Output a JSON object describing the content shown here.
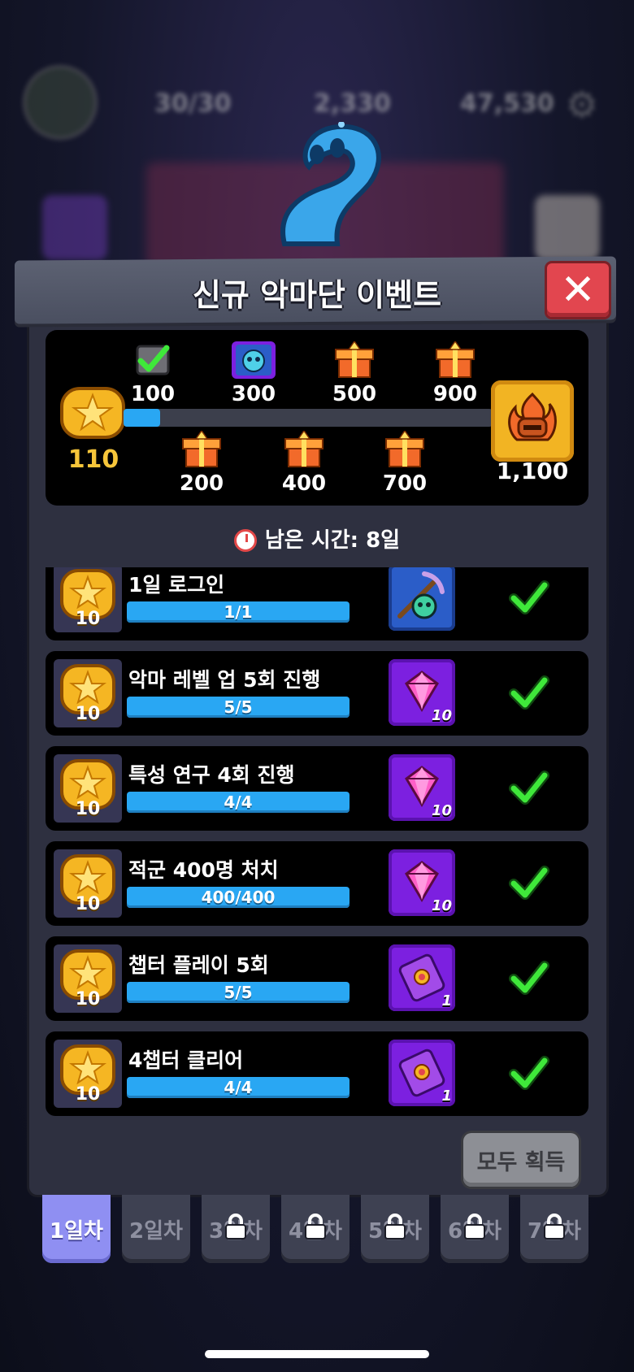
{
  "hud": {
    "energy": "30/30",
    "gems": "2,330",
    "gold": "47,530"
  },
  "title": "신규 악마단 이벤트",
  "progress": {
    "current_score": "110",
    "fill_fraction": 0.04,
    "milestones_top": [
      {
        "value": "100",
        "reward": "chest-claimed"
      },
      {
        "value": "300",
        "reward": "monster-icon"
      },
      {
        "value": "500",
        "reward": "gift-box"
      },
      {
        "value": "900",
        "reward": "gift-box"
      }
    ],
    "milestones_bottom": [
      {
        "value": "200",
        "reward": "gift-box"
      },
      {
        "value": "400",
        "reward": "gift-box"
      },
      {
        "value": "700",
        "reward": "gift-box"
      }
    ],
    "final_value": "1,100"
  },
  "timer": {
    "label": "남은 시간: 8일"
  },
  "missions": [
    {
      "label": "1일 로그인",
      "progress": "1/1",
      "points": "10",
      "reward": "skull-pickaxe",
      "qty": ""
    },
    {
      "label": "악마 레벨 업 5회 진행",
      "progress": "5/5",
      "points": "10",
      "reward": "gem",
      "qty": "10"
    },
    {
      "label": "특성 연구 4회 진행",
      "progress": "4/4",
      "points": "10",
      "reward": "gem",
      "qty": "10"
    },
    {
      "label": "적군 400명 처치",
      "progress": "400/400",
      "points": "10",
      "reward": "gem",
      "qty": "10"
    },
    {
      "label": "챕터 플레이 5회",
      "progress": "5/5",
      "points": "10",
      "reward": "scroll",
      "qty": "1"
    },
    {
      "label": "4챕터 클리어",
      "progress": "4/4",
      "points": "10",
      "reward": "scroll",
      "qty": "1"
    }
  ],
  "claim_all": "모두 획득",
  "tabs": [
    {
      "label": "1일차",
      "locked": false
    },
    {
      "label": "2일차",
      "locked": false
    },
    {
      "label": "3일차",
      "locked": true
    },
    {
      "label": "4일차",
      "locked": true
    },
    {
      "label": "5일차",
      "locked": true
    },
    {
      "label": "6일차",
      "locked": true
    },
    {
      "label": "7일차",
      "locked": true
    }
  ],
  "colors": {
    "progress": "#29a7f3",
    "check": "#3fe83a",
    "close": "#e2464f",
    "active_tab": "#8f8ff2"
  }
}
